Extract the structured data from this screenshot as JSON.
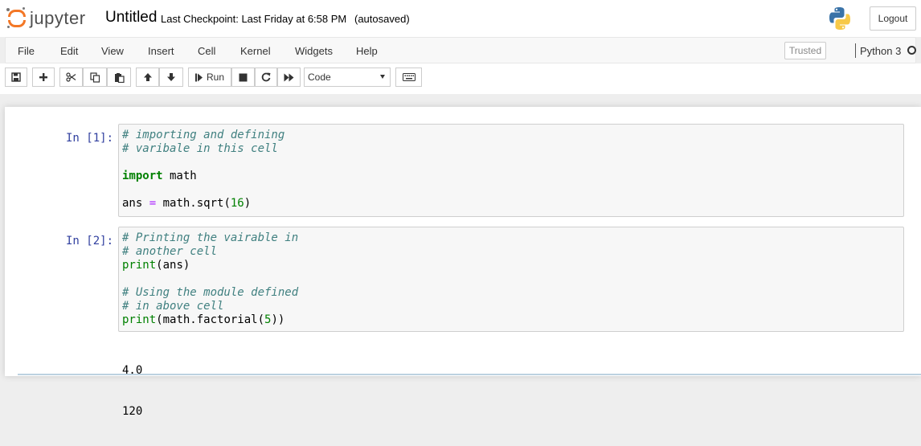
{
  "header": {
    "logo_text": "jupyter",
    "notebook_name": "Untitled",
    "checkpoint": "Last Checkpoint: Last Friday at 6:58 PM",
    "autosave": "(autosaved)",
    "logout_label": "Logout",
    "brand_color": "#f37726"
  },
  "menubar": {
    "items": [
      "File",
      "Edit",
      "View",
      "Insert",
      "Cell",
      "Kernel",
      "Widgets",
      "Help"
    ],
    "trusted_label": "Trusted",
    "kernel_name": "Python 3"
  },
  "toolbar": {
    "icons": [
      "save-icon",
      "plus-icon",
      "cut-icon",
      "copy-icon",
      "paste-icon",
      "arrow-up-icon",
      "arrow-down-icon",
      "run-icon",
      "stop-icon",
      "restart-icon",
      "fast-forward-icon",
      "keyboard-icon"
    ],
    "run_label": "Run",
    "cell_type": "Code"
  },
  "cells": [
    {
      "prompt": "In [1]:",
      "lines": [
        "# importing and defining",
        "# varibale in this cell",
        "",
        "import math",
        "",
        "ans = math.sqrt(16)"
      ],
      "output": ""
    },
    {
      "prompt": "In [2]:",
      "lines": [
        "# Printing the vairable in",
        "# another cell",
        "print(ans)",
        "",
        "# Using the module defined",
        "# in above cell",
        "print(math.factorial(5))"
      ],
      "output": [
        "4.0",
        "120"
      ]
    }
  ]
}
